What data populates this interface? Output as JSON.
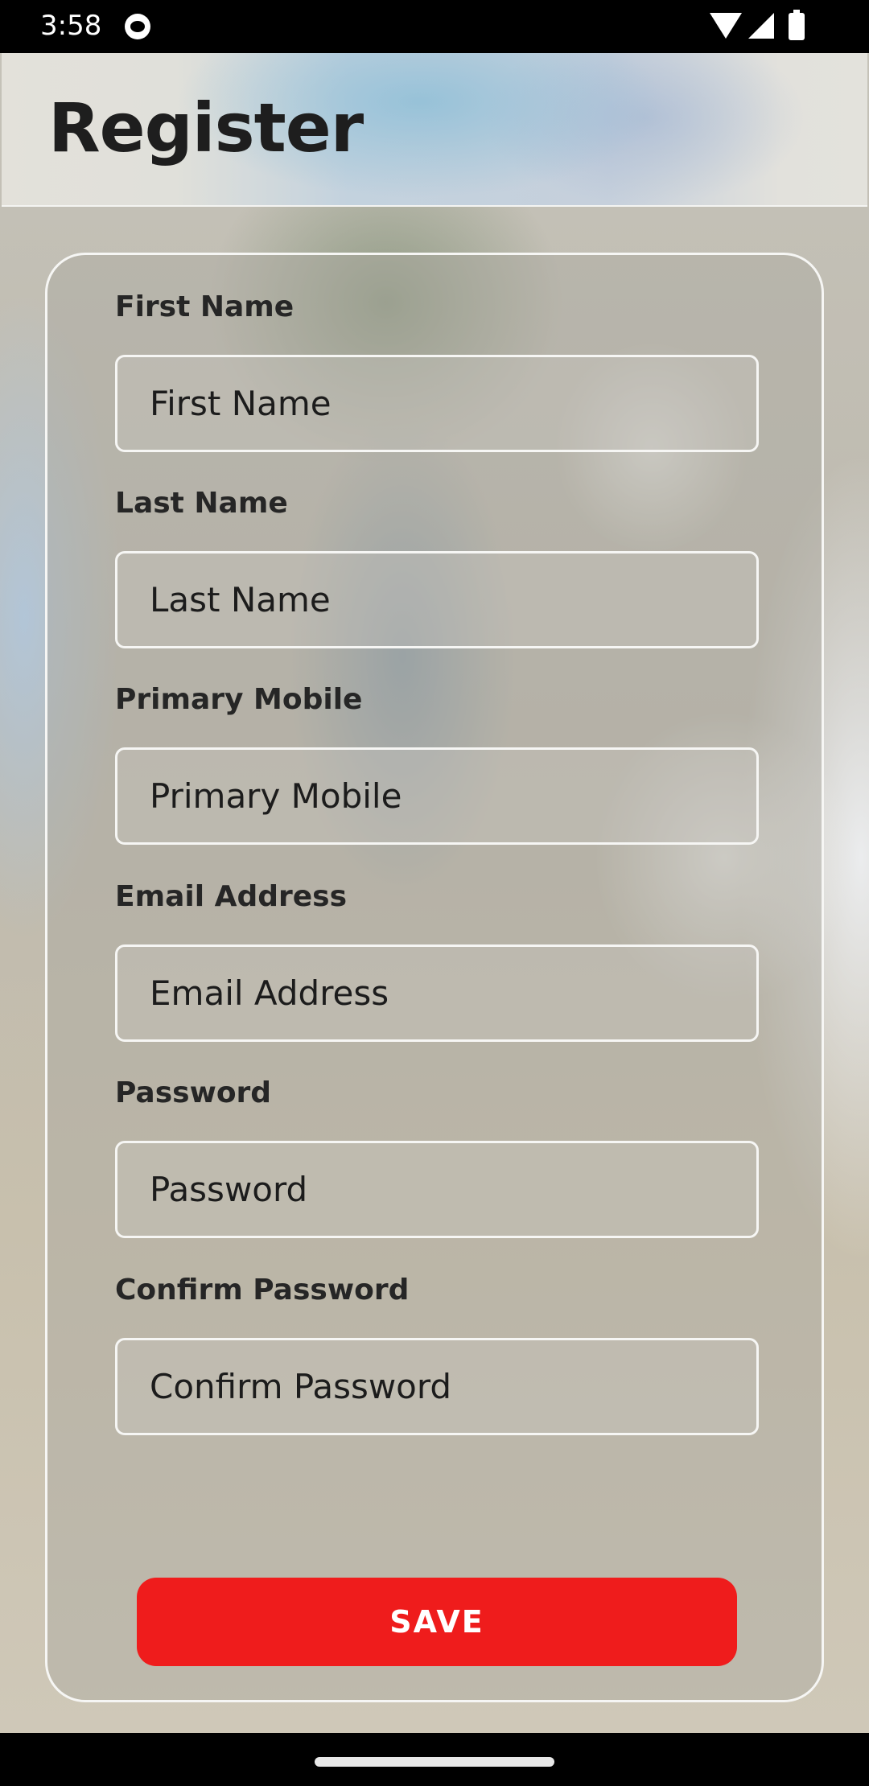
{
  "status_bar": {
    "time": "3:58",
    "icons": [
      "notification-cat-icon",
      "wifi-icon",
      "cell-signal-icon",
      "battery-icon"
    ]
  },
  "header": {
    "title": "Register"
  },
  "form": {
    "fields": [
      {
        "label": "First Name",
        "placeholder": "First Name",
        "value": ""
      },
      {
        "label": "Last Name",
        "placeholder": "Last Name",
        "value": ""
      },
      {
        "label": "Primary Mobile",
        "placeholder": "Primary Mobile",
        "value": ""
      },
      {
        "label": "Email Address",
        "placeholder": "Email Address",
        "value": ""
      },
      {
        "label": "Password",
        "placeholder": "Password",
        "value": ""
      },
      {
        "label": "Confirm Password",
        "placeholder": "Confirm Password",
        "value": ""
      }
    ],
    "save_label": "SAVE"
  },
  "colors": {
    "accent": "#ef1c1c",
    "title_text": "#1e1e1e",
    "border": "#f6f6f4"
  }
}
